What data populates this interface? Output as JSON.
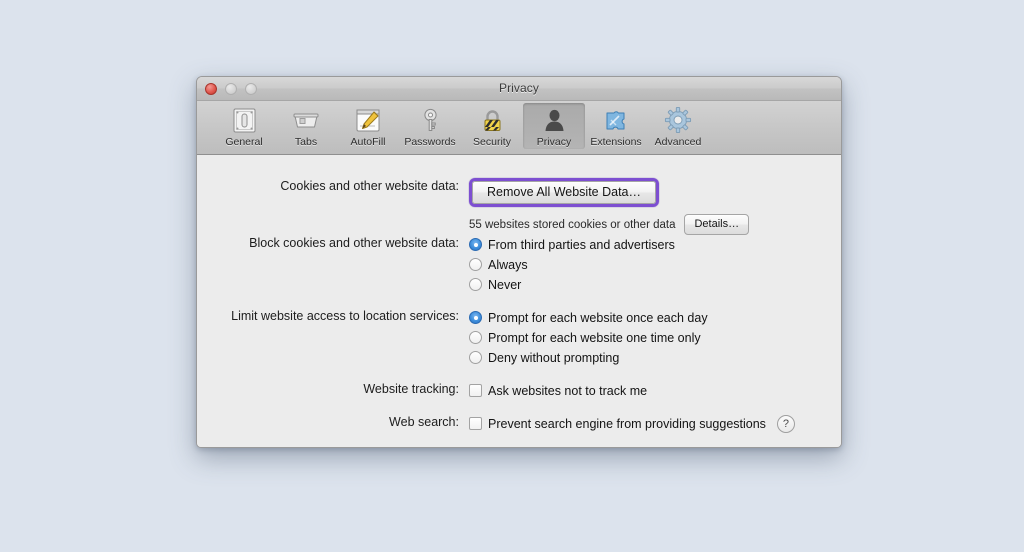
{
  "window": {
    "title": "Privacy",
    "controls": [
      {
        "name": "close",
        "label": "Close"
      },
      {
        "name": "minimize",
        "label": "Minimize"
      },
      {
        "name": "zoom",
        "label": "Zoom"
      }
    ]
  },
  "toolbar": {
    "items": [
      {
        "label": "General",
        "icon": "general-icon",
        "selected": false
      },
      {
        "label": "Tabs",
        "icon": "tabs-icon",
        "selected": false
      },
      {
        "label": "AutoFill",
        "icon": "autofill-icon",
        "selected": false
      },
      {
        "label": "Passwords",
        "icon": "key-icon",
        "selected": false
      },
      {
        "label": "Security",
        "icon": "padlock-icon",
        "selected": false
      },
      {
        "label": "Privacy",
        "icon": "person-icon",
        "selected": true
      },
      {
        "label": "Extensions",
        "icon": "puzzle-icon",
        "selected": false
      },
      {
        "label": "Advanced",
        "icon": "gear-icon",
        "selected": false
      }
    ]
  },
  "settings": {
    "cookies": {
      "label": "Cookies and other website data:",
      "remove_button": "Remove All Website Data…",
      "focused": true,
      "focus_color": "#7d4fd1",
      "status": "55 websites stored cookies or other data",
      "details_button": "Details…"
    },
    "block_cookies": {
      "label": "Block cookies and other website data:",
      "options": [
        {
          "label": "From third parties and advertisers",
          "selected": true
        },
        {
          "label": "Always",
          "selected": false
        },
        {
          "label": "Never",
          "selected": false
        }
      ]
    },
    "location": {
      "label": "Limit website access to location services:",
      "options": [
        {
          "label": "Prompt for each website once each day",
          "selected": true
        },
        {
          "label": "Prompt for each website one time only",
          "selected": false
        },
        {
          "label": "Deny without prompting",
          "selected": false
        }
      ]
    },
    "tracking": {
      "label": "Website tracking:",
      "checkbox_label": "Ask websites not to track me",
      "checked": false
    },
    "web_search": {
      "label": "Web search:",
      "checkbox_label": "Prevent search engine from providing suggestions",
      "checked": false,
      "help_button": "?"
    }
  },
  "colors": {
    "desktop_background": "#dce3ed",
    "content_background": "#ececec",
    "accent_selected_radio": "#3f8fdc",
    "focus_ring": "#7d4fd1"
  }
}
